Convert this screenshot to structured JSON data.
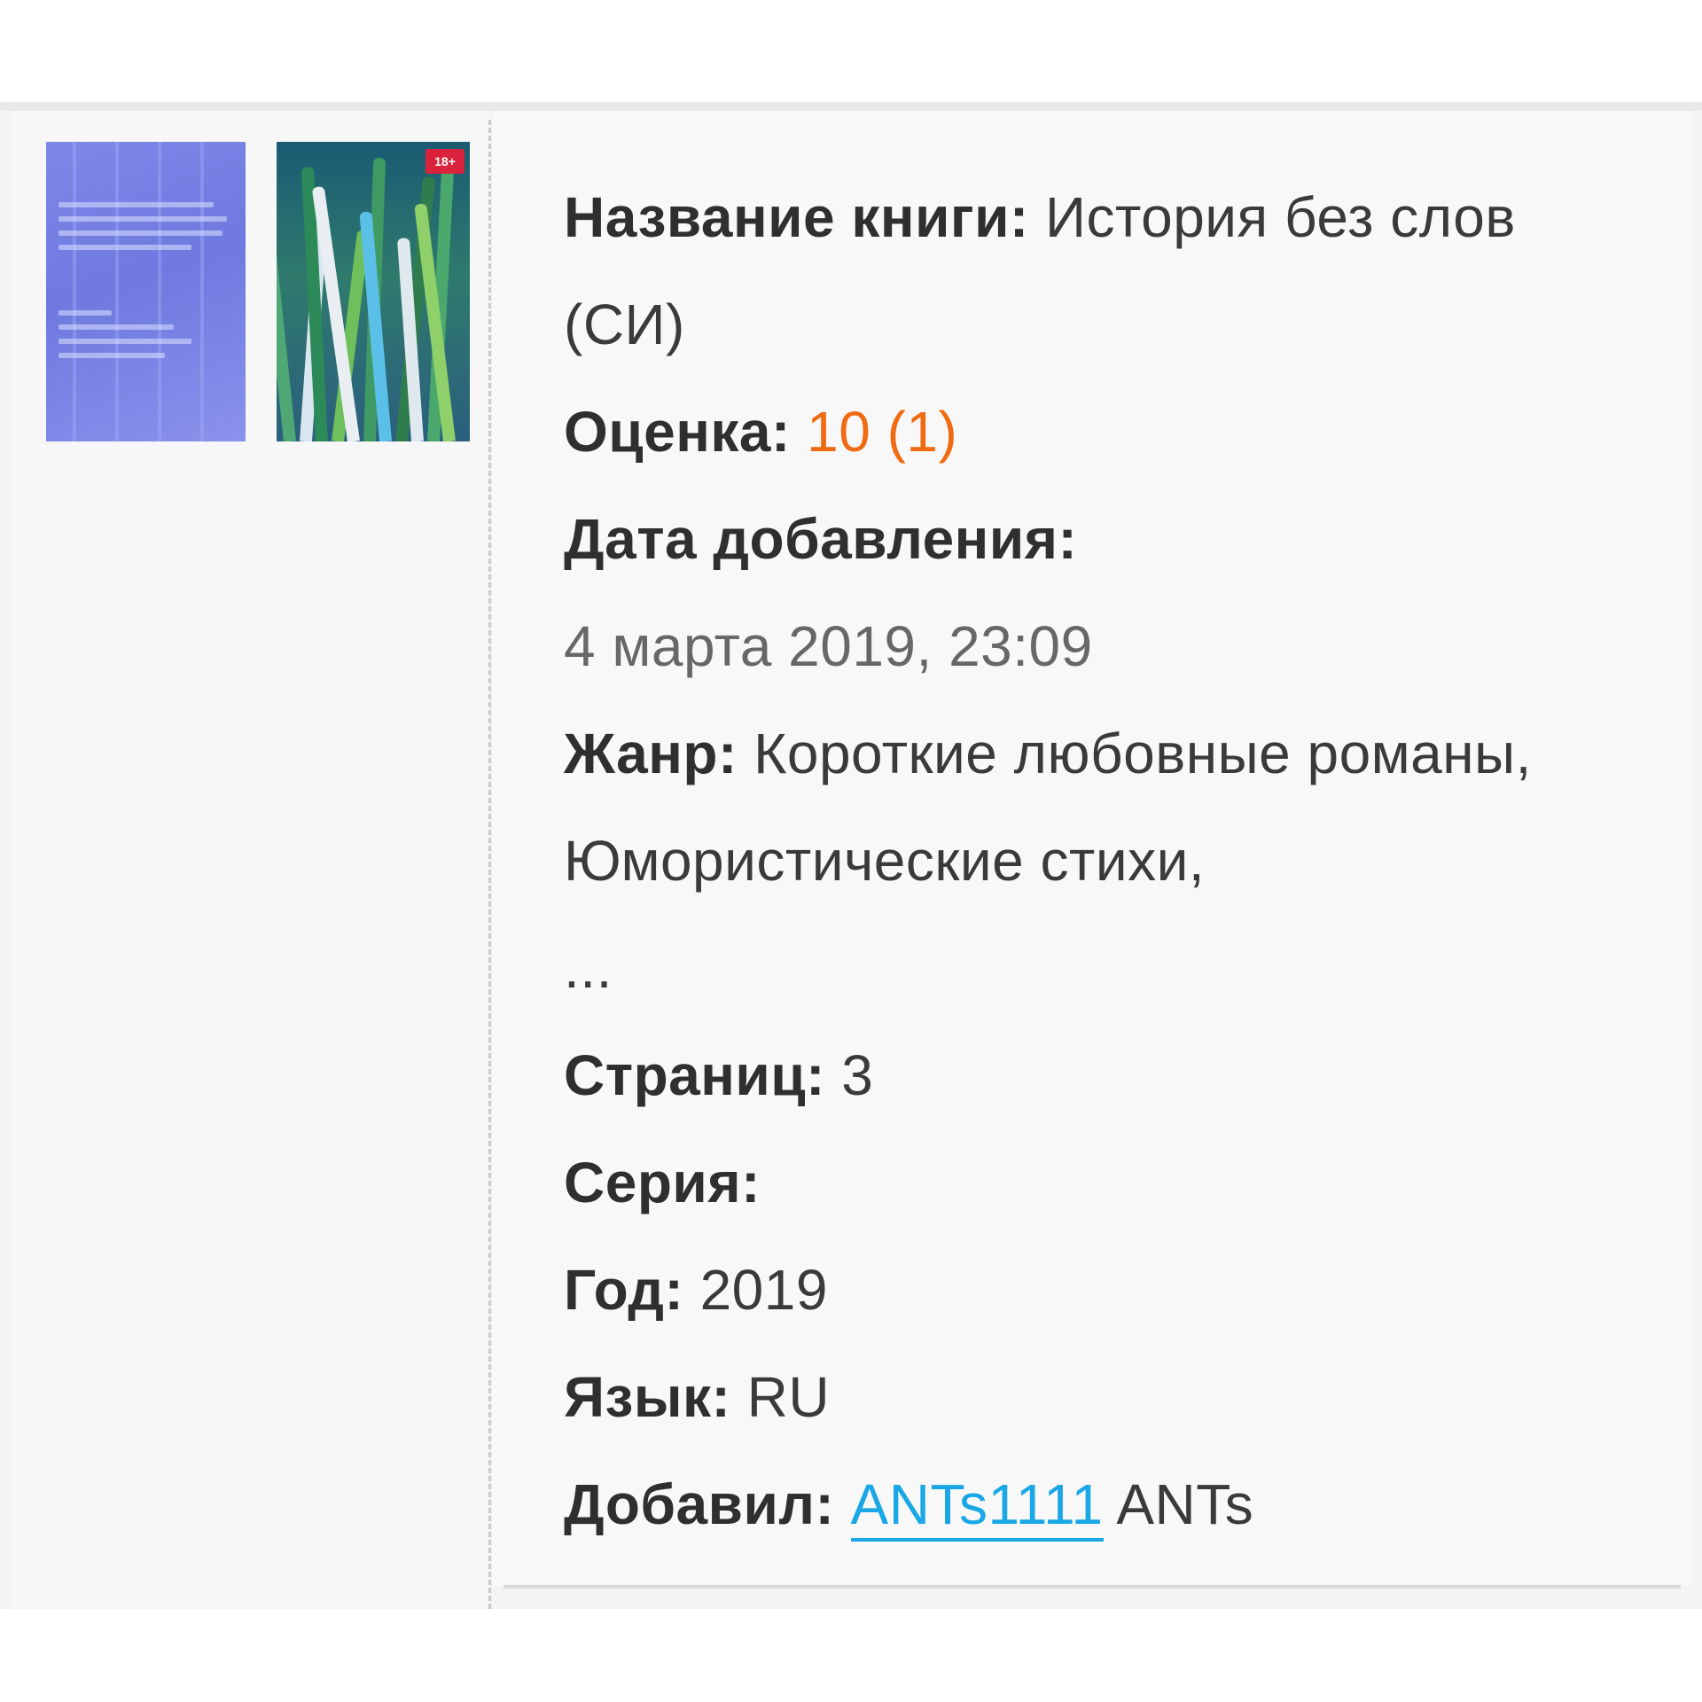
{
  "book": {
    "title_label": "Название книги:",
    "title_value": "История без слов (СИ)",
    "rating_label": "Оценка:",
    "rating_value": "10 (1)",
    "date_label": "Дата добавления:",
    "date_value": "4 марта 2019, 23:09",
    "genre_label": "Жанр:",
    "genre_value": "Короткие любовные романы, Юмористические стихи,",
    "genre_more": "...",
    "pages_label": "Страниц:",
    "pages_value": "3",
    "series_label": "Серия:",
    "series_value": "",
    "year_label": "Год:",
    "year_value": "2019",
    "language_label": "Язык:",
    "language_value": "RU",
    "added_by_label": "Добавил:",
    "added_by_link": "ANTs1111",
    "added_by_name": "ANTs"
  },
  "covers": {
    "badge": "18+"
  },
  "colors": {
    "rating": "#f06a12",
    "link": "#1aa7e6",
    "background": "#f8f8f8"
  }
}
